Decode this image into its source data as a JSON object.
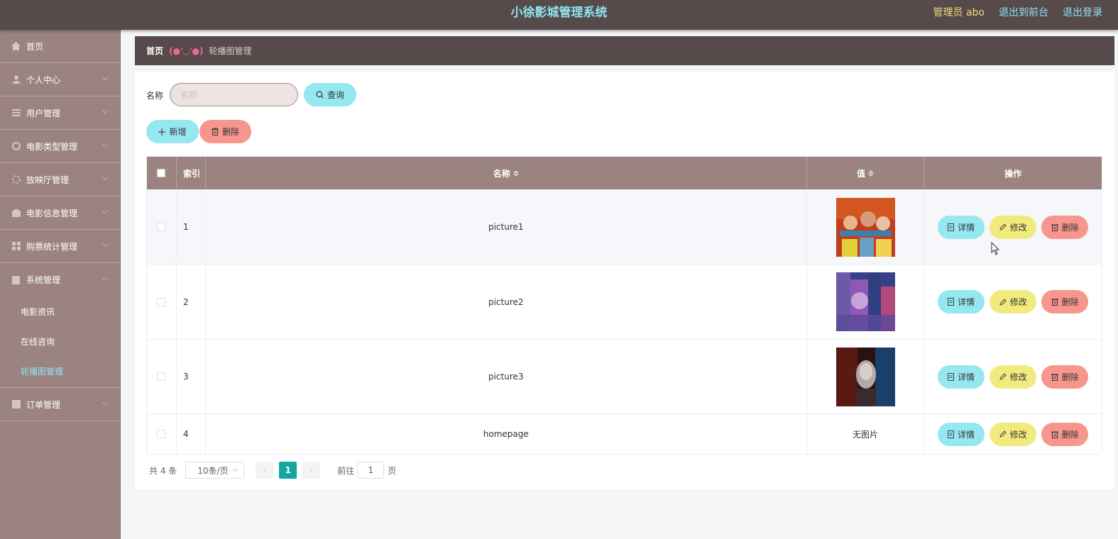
{
  "header": {
    "title": "小徐影城管理系统",
    "admin_label": "管理员 abo",
    "to_front_label": "退出到前台",
    "logout_label": "退出登录"
  },
  "sidebar": {
    "items": [
      {
        "label": "首页",
        "icon": "home-icon"
      },
      {
        "label": "个人中心",
        "icon": "user-icon"
      },
      {
        "label": "用户管理",
        "icon": "list-icon"
      },
      {
        "label": "电影类型管理",
        "icon": "film-icon"
      },
      {
        "label": "放映厅管理",
        "icon": "hall-icon"
      },
      {
        "label": "电影信息管理",
        "icon": "info-icon"
      },
      {
        "label": "购票统计管理",
        "icon": "grid-icon"
      },
      {
        "label": "系统管理",
        "icon": "system-icon"
      },
      {
        "label": "订单管理",
        "icon": "order-icon"
      }
    ],
    "system_subitems": [
      "电影资讯",
      "在线咨询",
      "轮播图管理"
    ]
  },
  "breadcrumb": {
    "home": "首页",
    "separator": "(●'◡'●)",
    "current": "轮播图管理"
  },
  "search": {
    "label": "名称",
    "placeholder": "名称",
    "query_label": "查询"
  },
  "actions": {
    "add_label": "新增",
    "delete_label": "删除"
  },
  "table": {
    "headers": {
      "index": "索引",
      "name": "名称",
      "value": "值",
      "ops": "操作"
    },
    "rows": [
      {
        "index": "1",
        "name": "picture1",
        "value": "",
        "has_image": true
      },
      {
        "index": "2",
        "name": "picture2",
        "value": "",
        "has_image": true
      },
      {
        "index": "3",
        "name": "picture3",
        "value": "",
        "has_image": true
      },
      {
        "index": "4",
        "name": "homepage",
        "value": "无图片",
        "has_image": false
      }
    ],
    "op_labels": {
      "detail": "详情",
      "edit": "修改",
      "delete": "删除"
    }
  },
  "pagination": {
    "total": "共 4 条",
    "page_size": "10条/页",
    "current_page": "1",
    "goto_label": "前往",
    "goto_value": "1",
    "page_suffix": "页"
  },
  "colors": {
    "topbar": "#564a4a",
    "sidebar": "#9b8480",
    "accent_cyan": "#95e7f0",
    "accent_red": "#f7968c",
    "accent_yellow": "#f1ea7d",
    "pager_active": "#13a89e"
  }
}
